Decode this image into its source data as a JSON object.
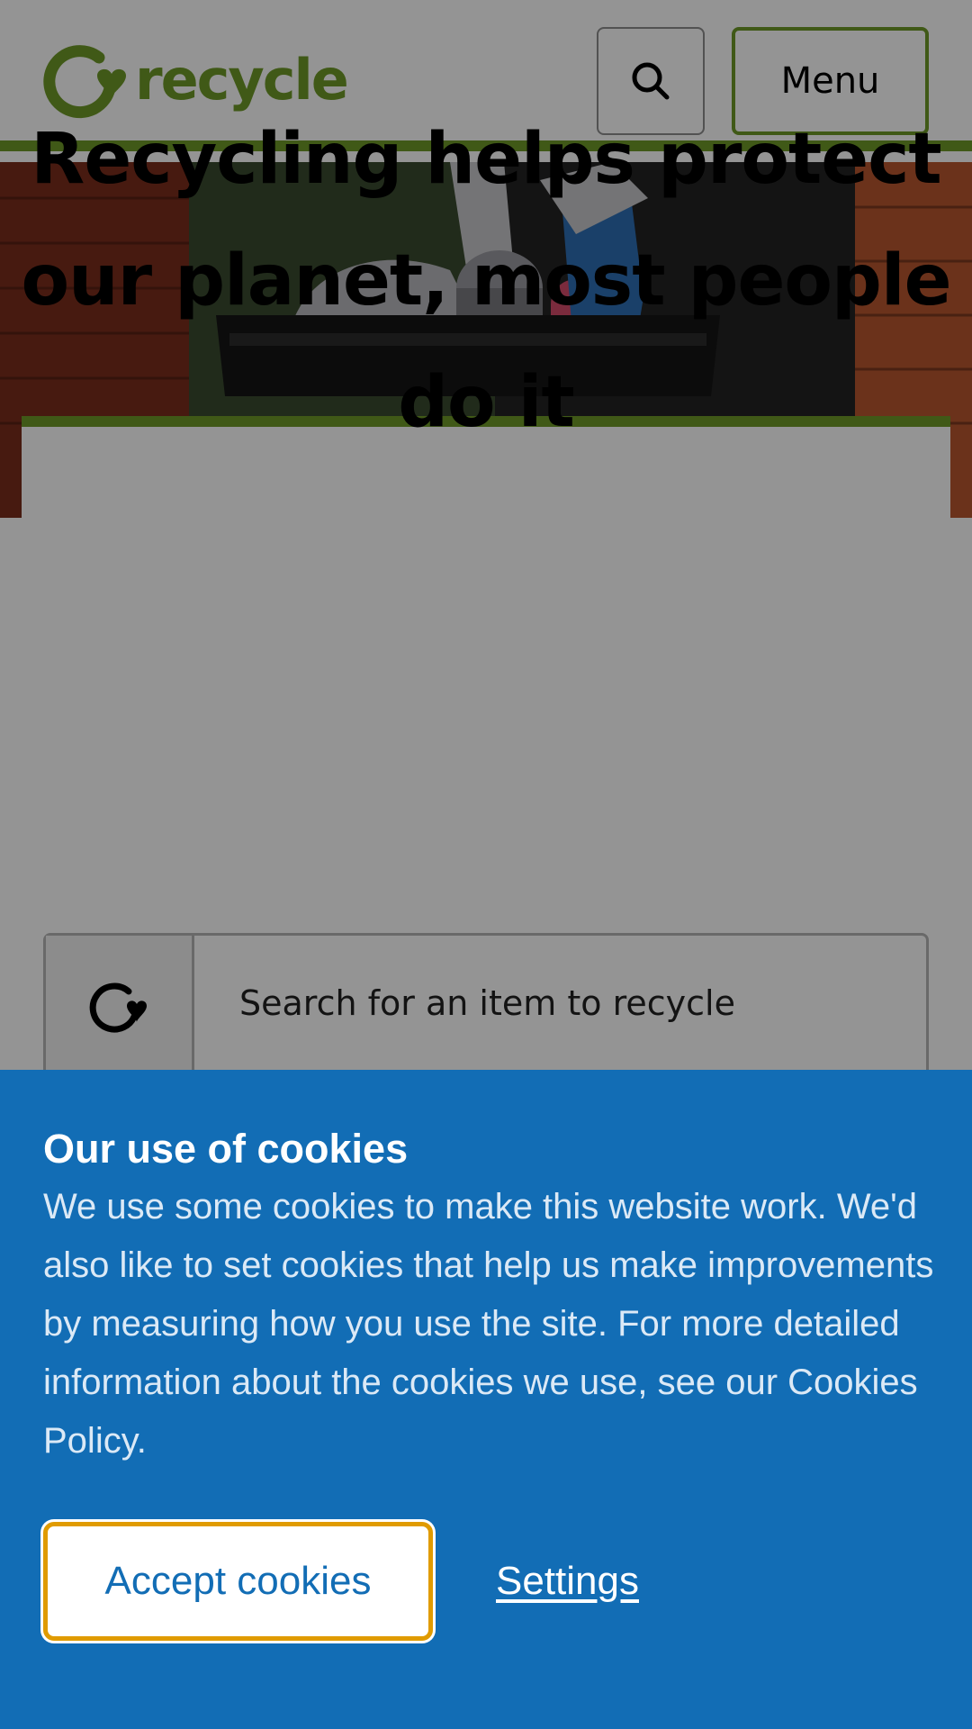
{
  "header": {
    "logo_text": "recycle",
    "search_button_icon": "search-icon",
    "menu_label": "Menu"
  },
  "hero": {
    "image_description_icon": "recycling-bin-photo"
  },
  "main": {
    "headline_lines": [
      "Recycling helps protect",
      "our planet, most people",
      "do it"
    ],
    "item_search": {
      "icon": "recycle-arrow-icon",
      "placeholder": "Search for an item to recycle"
    }
  },
  "cookie_banner": {
    "title": "Our use of cookies",
    "body": "We use some cookies to make this website work. We'd also like to set cookies that help us make improvements by measuring how you use the site. For more detailed information about the cookies we use, see our Cookies Policy.",
    "accept_label": "Accept cookies",
    "settings_label": "Settings"
  },
  "colors": {
    "brand_green": "#6e9a28",
    "banner_blue": "#126db5",
    "focus_orange": "#e09b00"
  }
}
